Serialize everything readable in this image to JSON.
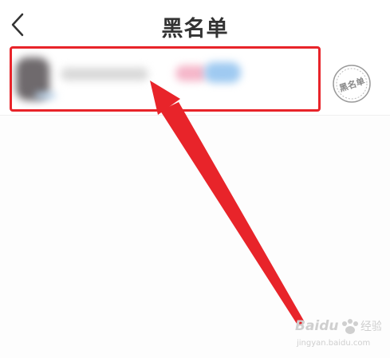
{
  "header": {
    "title": "黑名单",
    "back_icon": "chevron-left-icon"
  },
  "list": {
    "items": [
      {
        "stamp_text": "黑名单",
        "stamp_icon": "blacklist-stamp-icon"
      }
    ]
  },
  "annotation": {
    "box_color": "#e8242a",
    "arrow_color": "#e8242a"
  },
  "watermark": {
    "logo": "Baidu",
    "label": "经验",
    "url": "jingyan.baidu.com"
  }
}
